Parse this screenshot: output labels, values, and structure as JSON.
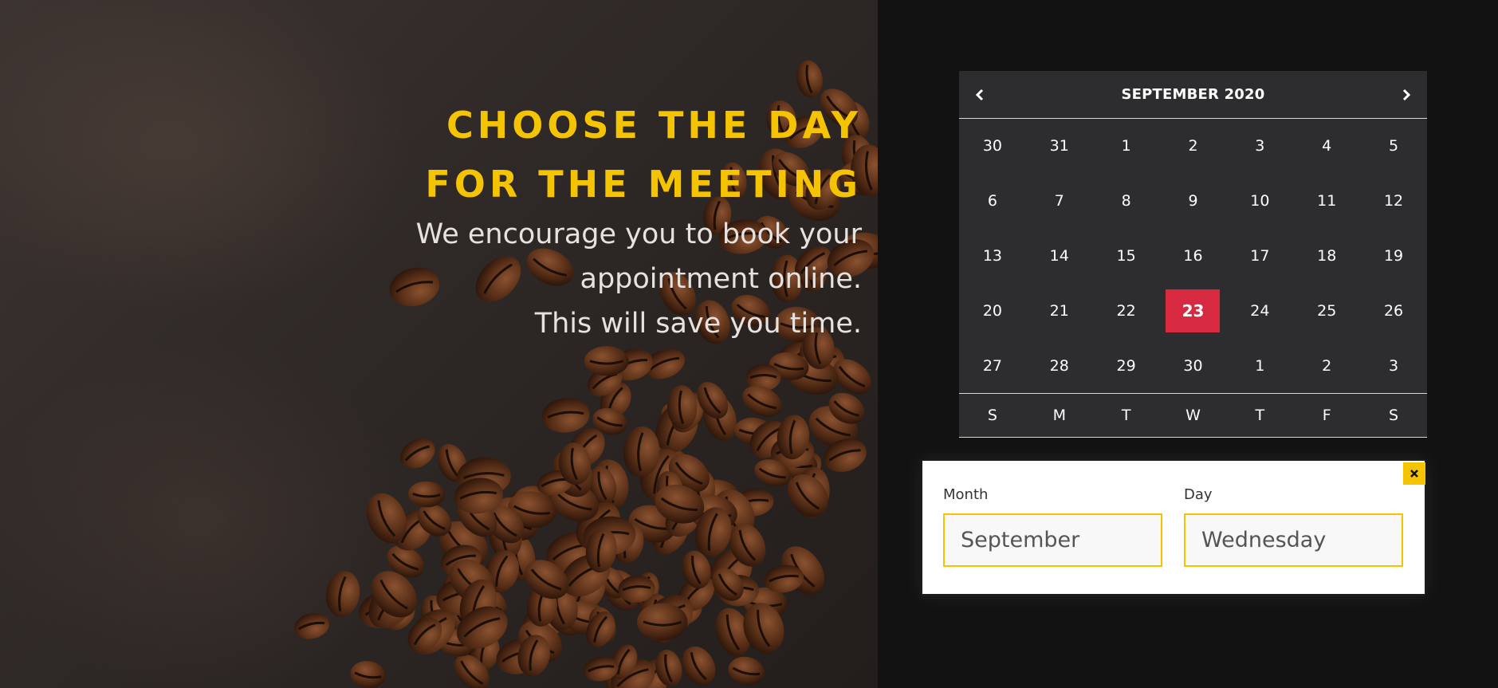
{
  "hero": {
    "title_line1": "CHOOSE THE DAY",
    "title_line2": "FOR THE MEETING",
    "subtitle_line1": "We encourage you to book your",
    "subtitle_line2": "appointment online.",
    "subtitle_line3": "This will save you time."
  },
  "calendar": {
    "title": "SEPTEMBER 2020",
    "prev_icon": "chevron-left-icon",
    "next_icon": "chevron-right-icon",
    "selected_day": "23",
    "days": [
      [
        "30",
        "31",
        "1",
        "2",
        "3",
        "4",
        "5"
      ],
      [
        "6",
        "7",
        "8",
        "9",
        "10",
        "11",
        "12"
      ],
      [
        "13",
        "14",
        "15",
        "16",
        "17",
        "18",
        "19"
      ],
      [
        "20",
        "21",
        "22",
        "23",
        "24",
        "25",
        "26"
      ],
      [
        "27",
        "28",
        "29",
        "30",
        "1",
        "2",
        "3"
      ]
    ],
    "weekdays": [
      "S",
      "M",
      "T",
      "W",
      "T",
      "F",
      "S"
    ]
  },
  "selection": {
    "month_label": "Month",
    "month_value": "September",
    "day_label": "Day",
    "day_value": "Wednesday",
    "close_icon": "close-icon"
  },
  "colors": {
    "accent": "#f5c400",
    "selected": "#d7293f",
    "calendar_bg": "#2d2d2f",
    "panel_bg": "#121212"
  }
}
